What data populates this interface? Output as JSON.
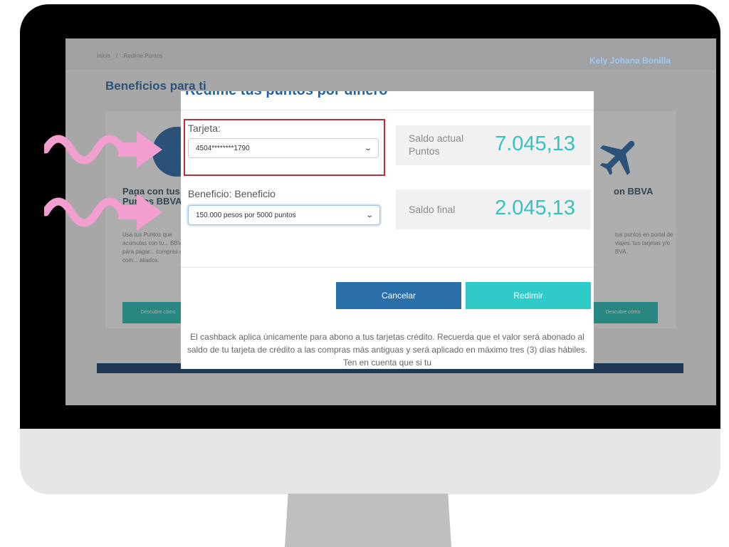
{
  "header": {
    "breadcrumb": [
      "Inicio",
      "Redime Puntos"
    ],
    "user_name": "Kely Johana Bonilla"
  },
  "page": {
    "title": "Beneficios para ti"
  },
  "cards": {
    "left": {
      "title": "Paga con tus Puntos BBVA W...",
      "text": "Usa tus Puntos que acumulas con tu... BBVA para pagar... compras en com... aliados.",
      "button": "Descubre cómo"
    },
    "right": {
      "title": "on BBVA",
      "text": "tus puntos en portal de viajes. tus tarjetas y/o BVA.",
      "button": "Descubre cómo"
    }
  },
  "modal": {
    "title": "Redime tus puntos por dinero",
    "card_label": "Tarjeta:",
    "card_value": "4504********1790",
    "benefit_label": "Beneficio: Beneficio",
    "benefit_value": "150.000 pesos por 5000 puntos",
    "balance_current_label_line1": "Saldo actual",
    "balance_current_label_line2": "Puntos",
    "balance_current_value": "7.045,13",
    "balance_final_label": "Saldo final",
    "balance_final_value": "2.045,13",
    "cancel_label": "Cancelar",
    "redeem_label": "Redimir",
    "note": "El cashback aplica únicamente para abono a tus tarjetas crédito. Recuerda que el valor será abonado al saldo de tu tarjeta de crédito a las compras más antiguas y será aplicado en máximo tres (3) días hábiles. Ten en cuenta que si tu"
  },
  "colors": {
    "brand_blue": "#1f62a6",
    "accent_teal": "#35c3c1",
    "highlight_red": "#b8323a",
    "annotation_pink": "#f29fcf"
  }
}
